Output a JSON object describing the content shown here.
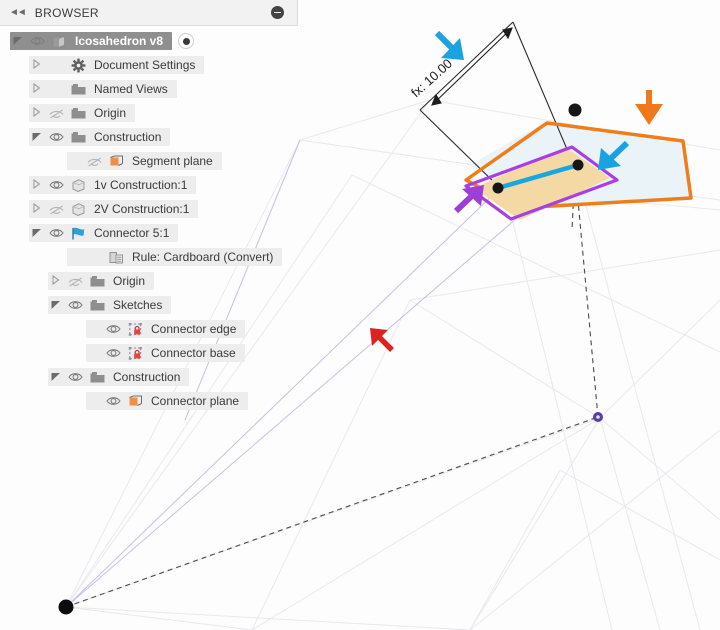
{
  "panel": {
    "title": "BROWSER",
    "collapse_icon": "collapse-left-icon",
    "collapse_glyph": "◄◄",
    "minimize_icon": "minimize-icon"
  },
  "tree": {
    "nodes": [
      {
        "label": "Icosahedron v8",
        "icon": "component-icon",
        "twisty": "open",
        "eye": "visible",
        "indent": 1,
        "selected": true,
        "radio": true
      },
      {
        "label": "Document Settings",
        "icon": "gear-icon",
        "twisty": "closed",
        "eye": "none",
        "indent": 2,
        "selected": false,
        "radio": false
      },
      {
        "label": "Named Views",
        "icon": "folder-icon",
        "twisty": "closed",
        "eye": "none",
        "indent": 2,
        "selected": false,
        "radio": false
      },
      {
        "label": "Origin",
        "icon": "folder-icon",
        "twisty": "closed",
        "eye": "hidden",
        "indent": 2,
        "selected": false,
        "radio": false
      },
      {
        "label": "Construction",
        "icon": "folder-icon",
        "twisty": "open",
        "eye": "visible",
        "indent": 2,
        "selected": false,
        "radio": false
      },
      {
        "label": "Segment plane",
        "icon": "plane-icon",
        "twisty": "none",
        "eye": "hidden",
        "indent": 4,
        "selected": false,
        "radio": false
      },
      {
        "label": "1v Construction:1",
        "icon": "body-icon",
        "twisty": "closed",
        "eye": "visible",
        "indent": 2,
        "selected": false,
        "radio": false
      },
      {
        "label": "2V Construction:1",
        "icon": "body-icon",
        "twisty": "closed",
        "eye": "hidden",
        "indent": 2,
        "selected": false,
        "radio": false
      },
      {
        "label": "Connector 5:1",
        "icon": "connector-icon",
        "twisty": "open",
        "eye": "visible",
        "indent": 2,
        "selected": false,
        "radio": false
      },
      {
        "label": "Rule: Cardboard (Convert)",
        "icon": "rule-icon",
        "twisty": "none",
        "eye": "none",
        "indent": 4,
        "selected": false,
        "radio": false
      },
      {
        "label": "Origin",
        "icon": "folder-icon",
        "twisty": "closed",
        "eye": "hidden",
        "indent": 3,
        "selected": false,
        "radio": false
      },
      {
        "label": "Sketches",
        "icon": "folder-icon",
        "twisty": "open",
        "eye": "visible",
        "indent": 3,
        "selected": false,
        "radio": false
      },
      {
        "label": "Connector edge",
        "icon": "sketch-locked-icon",
        "twisty": "none",
        "eye": "visible",
        "indent": 5,
        "selected": false,
        "radio": false
      },
      {
        "label": "Connector base",
        "icon": "sketch-locked-icon",
        "twisty": "none",
        "eye": "visible",
        "indent": 5,
        "selected": false,
        "radio": false
      },
      {
        "label": "Construction",
        "icon": "folder-icon",
        "twisty": "open",
        "eye": "visible",
        "indent": 3,
        "selected": false,
        "radio": false
      },
      {
        "label": "Connector plane",
        "icon": "plane-icon",
        "twisty": "none",
        "eye": "visible",
        "indent": 5,
        "selected": false,
        "radio": false
      }
    ]
  },
  "viewport": {
    "dimension_label": "fx: 10.00",
    "annotations": [
      {
        "name": "blue-arrow-dimension",
        "color": "#1aa3e0",
        "direction": "down-right"
      },
      {
        "name": "orange-arrow-outer-profile",
        "color": "#f07818",
        "direction": "down"
      },
      {
        "name": "blue-arrow-selected-edge",
        "color": "#1aa3e0",
        "direction": "down-left"
      },
      {
        "name": "purple-arrow-inner-profile",
        "color": "#9b3fd6",
        "direction": "up-right"
      },
      {
        "name": "red-arrow-empty-area",
        "color": "#dd2222",
        "direction": "up-left"
      }
    ],
    "colors": {
      "outer_profile": "#ef7d1a",
      "inner_profile": "#a93fe0",
      "selected_edge": "#19a8dc",
      "face_fill": "#f5d9a5",
      "plane_fill": "#eaf4f8",
      "wireframe": "#e8e8ec",
      "construction_line": "#8e8ebf"
    }
  }
}
